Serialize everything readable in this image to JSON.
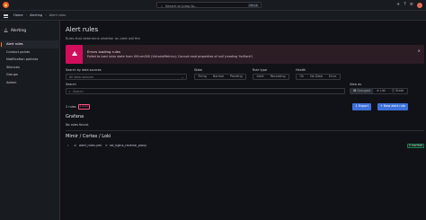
{
  "topbar": {
    "search_placeholder": "Search or jump to...",
    "search_shortcut": "ctrl+k",
    "icons": [
      "grafana-logo-icon",
      "plus-icon",
      "help-icon",
      "news-icon",
      "avatar"
    ]
  },
  "breadcrumbs": [
    "Home",
    "Alerting",
    "Alert rules"
  ],
  "sidebar": {
    "title": "Alerting",
    "items": [
      {
        "label": "Alert rules",
        "active": true
      },
      {
        "label": "Contact points",
        "active": false
      },
      {
        "label": "Notification policies",
        "active": false
      },
      {
        "label": "Silences",
        "active": false
      },
      {
        "label": "Groups",
        "active": false
      },
      {
        "label": "Admin",
        "active": false
      }
    ]
  },
  "page": {
    "title": "Alert rules",
    "subtitle": "Rules that determine whether an alert will fire"
  },
  "error_alert": {
    "title": "Errors loading rules",
    "message": "Failed to load rules state from VM-vm000 (VictoriaMetrics): Cannot read properties of null (reading 'forEach')",
    "color": "#d10e5c"
  },
  "filters": {
    "data_source_label": "Search by data sources",
    "data_source_placeholder": "All data sources",
    "state_label": "State",
    "state_options": [
      "Firing",
      "Normal",
      "Pending"
    ],
    "rule_type_label": "Rule type",
    "rule_type_options": [
      "Alert",
      "Recording"
    ],
    "health_label": "Health",
    "health_options": [
      "Ok",
      "No Data",
      "Error"
    ],
    "search_label": "Search",
    "search_placeholder": "Search",
    "view_as_label": "View as",
    "view_as_options": [
      "Grouped",
      "List",
      "State"
    ],
    "view_as_selected": "Grouped"
  },
  "summary": {
    "text": "2 rules",
    "error_badge": "1 error"
  },
  "actions": {
    "export_label": "Export",
    "new_rule_label": "New alert rule",
    "primary_color": "#3d71d9"
  },
  "sections": {
    "grafana_title": "Grafana",
    "grafana_empty": "No rules found.",
    "mimir_title": "Mimir / Cortex / Loki"
  },
  "namespace_row": {
    "namespace": "alert_rules.yml",
    "separator": ">",
    "group": "ssl_nginx_reverse_proxy",
    "badge": "2 normal"
  }
}
